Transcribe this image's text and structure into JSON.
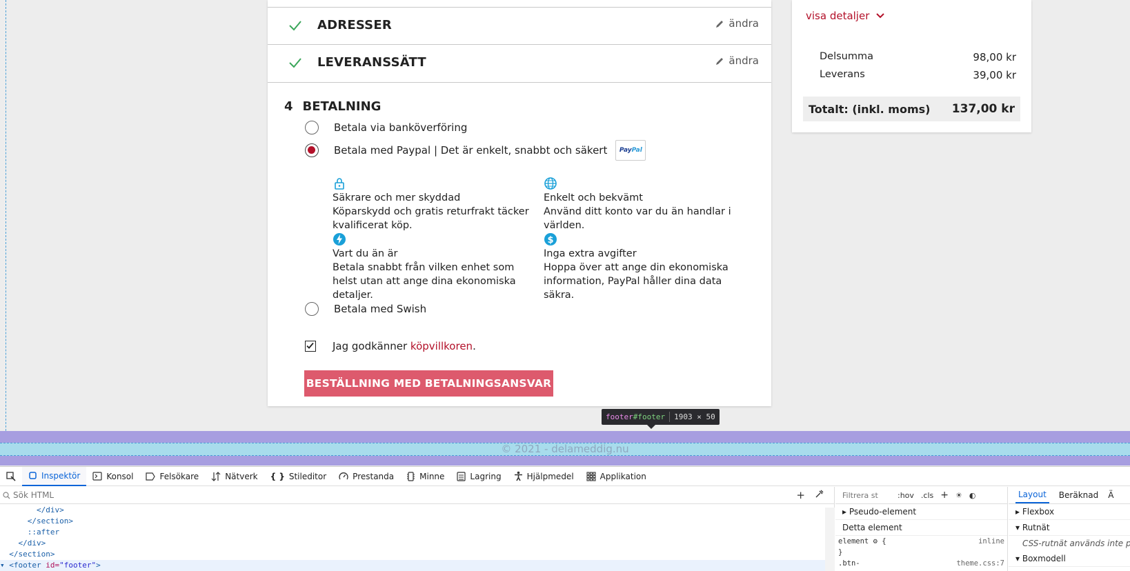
{
  "checkout": {
    "steps": [
      {
        "title": "ADRESSER",
        "edit": "ändra"
      },
      {
        "title": "LEVERANSSÄTT",
        "edit": "ändra"
      }
    ],
    "payment": {
      "number": "4",
      "title": "BETALNING",
      "options": [
        {
          "label": "Betala via banköverföring",
          "selected": false
        },
        {
          "label": "Betala med Paypal | Det är enkelt, snabbt och säkert",
          "selected": true,
          "logo": "PayPal"
        },
        {
          "label": "Betala med Swish",
          "selected": false
        }
      ],
      "features": [
        {
          "icon": "lock-icon",
          "title": "Säkrare och mer skyddad",
          "text": "Köparskydd och gratis returfrakt täcker kvalificerat köp."
        },
        {
          "icon": "globe-icon",
          "title": "Enkelt och bekvämt",
          "text": "Använd ditt konto var du än handlar i världen."
        },
        {
          "icon": "bolt-icon",
          "title": "Vart du än är",
          "text": "Betala snabbt från vilken enhet som helst utan att ange dina ekonomiska detaljer."
        },
        {
          "icon": "dollar-icon",
          "title": "Inga extra avgifter",
          "text": "Hoppa över att ange din ekonomiska information, PayPal håller dina data säkra."
        }
      ],
      "terms_prefix": "Jag godkänner ",
      "terms_link": "köpvillkoren",
      "terms_suffix": ".",
      "terms_checked": true,
      "order_button": "BESTÄLLNING MED BETALNINGSANSVAR"
    }
  },
  "summary": {
    "details_link": "visa detaljer",
    "rows": [
      {
        "label": "Delsumma",
        "value": "98,00 kr"
      },
      {
        "label": "Leverans",
        "value": "39,00 kr"
      }
    ],
    "total_label": "Totalt: (inkl. moms)",
    "total_value": "137,00 kr"
  },
  "tooltip": {
    "tag": "footer",
    "id": "#footer",
    "size": "1903 × 50"
  },
  "footer": {
    "text": "© 2021 - delameddig.nu"
  },
  "devtools": {
    "tabs": [
      {
        "label": "Inspektör",
        "icon": "inspector-icon",
        "active": true
      },
      {
        "label": "Konsol",
        "icon": "console-icon"
      },
      {
        "label": "Felsökare",
        "icon": "debugger-icon"
      },
      {
        "label": "Nätverk",
        "icon": "network-icon"
      },
      {
        "label": "Stileditor",
        "icon": "braces-icon"
      },
      {
        "label": "Prestanda",
        "icon": "gauge-icon"
      },
      {
        "label": "Minne",
        "icon": "memory-icon"
      },
      {
        "label": "Lagring",
        "icon": "storage-icon"
      },
      {
        "label": "Hjälpmedel",
        "icon": "accessibility-icon"
      },
      {
        "label": "Applikation",
        "icon": "grid-icon"
      }
    ],
    "search_placeholder": "Sök HTML",
    "code_lines": [
      {
        "indent": "        ",
        "text": "</div>"
      },
      {
        "indent": "      ",
        "text": "</section>"
      },
      {
        "indent": "      ",
        "text": "::after"
      },
      {
        "indent": "    ",
        "text": "</div>"
      },
      {
        "indent": "  ",
        "text": "</section>"
      }
    ],
    "selected_line": {
      "prefix": "▾ <",
      "tag": "footer",
      "attr": " id=",
      "val": "\"footer\"",
      "suffix": ">"
    },
    "filter_placeholder": "Filtrera st",
    "filter_hov": ":hov",
    "filter_cls": ".cls",
    "pseudo": "Pseudo-element",
    "this_element": "Detta element",
    "element_rule": "element ⚙ {",
    "element_source": "inline",
    "close_brace": "}",
    "next_rule": ".btn-",
    "next_source": "theme.css:7",
    "layout_tabs": [
      "Layout",
      "Beräknad",
      "Ä"
    ],
    "flexbox": "Flexbox",
    "grid": "Rutnät",
    "grid_note": "CSS-rutnät används inte på d",
    "boxmodel": "Boxmodell"
  },
  "colors": {
    "accent": "#b3112a",
    "button": "#dd5a6d",
    "check": "#3aa65a",
    "paypal_icons": "#1aa0d8"
  }
}
